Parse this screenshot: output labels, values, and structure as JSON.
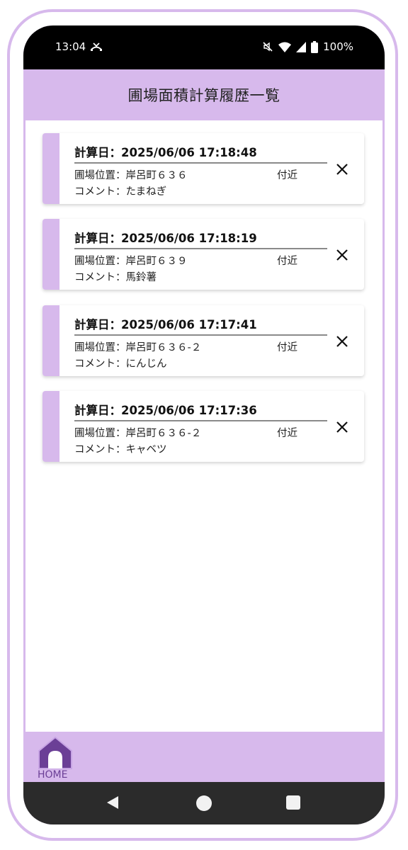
{
  "status_bar": {
    "time": "13:04",
    "battery": "100%",
    "icons": [
      "missed-call-icon",
      "mute-icon",
      "wifi-icon",
      "signal-icon",
      "battery-icon"
    ]
  },
  "header": {
    "title": "圃場面積計算履歴一覧"
  },
  "history": [
    {
      "date": "計算日：2025/06/06 17:18:48",
      "location": "圃場位置：岸呂町６３６",
      "near": "付近",
      "comment": "コメント：たまねぎ"
    },
    {
      "date": "計算日：2025/06/06 17:18:19",
      "location": "圃場位置：岸呂町６３９",
      "near": "付近",
      "comment": "コメント：馬鈴薯"
    },
    {
      "date": "計算日：2025/06/06 17:17:41",
      "location": "圃場位置：岸呂町６３６-２",
      "near": "付近",
      "comment": "コメント：にんじん"
    },
    {
      "date": "計算日：2025/06/06 17:17:36",
      "location": "圃場位置：岸呂町６３６-２",
      "near": "付近",
      "comment": "コメント：キャベツ"
    }
  ],
  "bottom_nav": {
    "home_label": "HOME"
  },
  "colors": {
    "accent": "#d7b9ec",
    "home_icon": "#6b3f96",
    "status_bar": "#000000",
    "system_nav": "#2b2b2b"
  }
}
